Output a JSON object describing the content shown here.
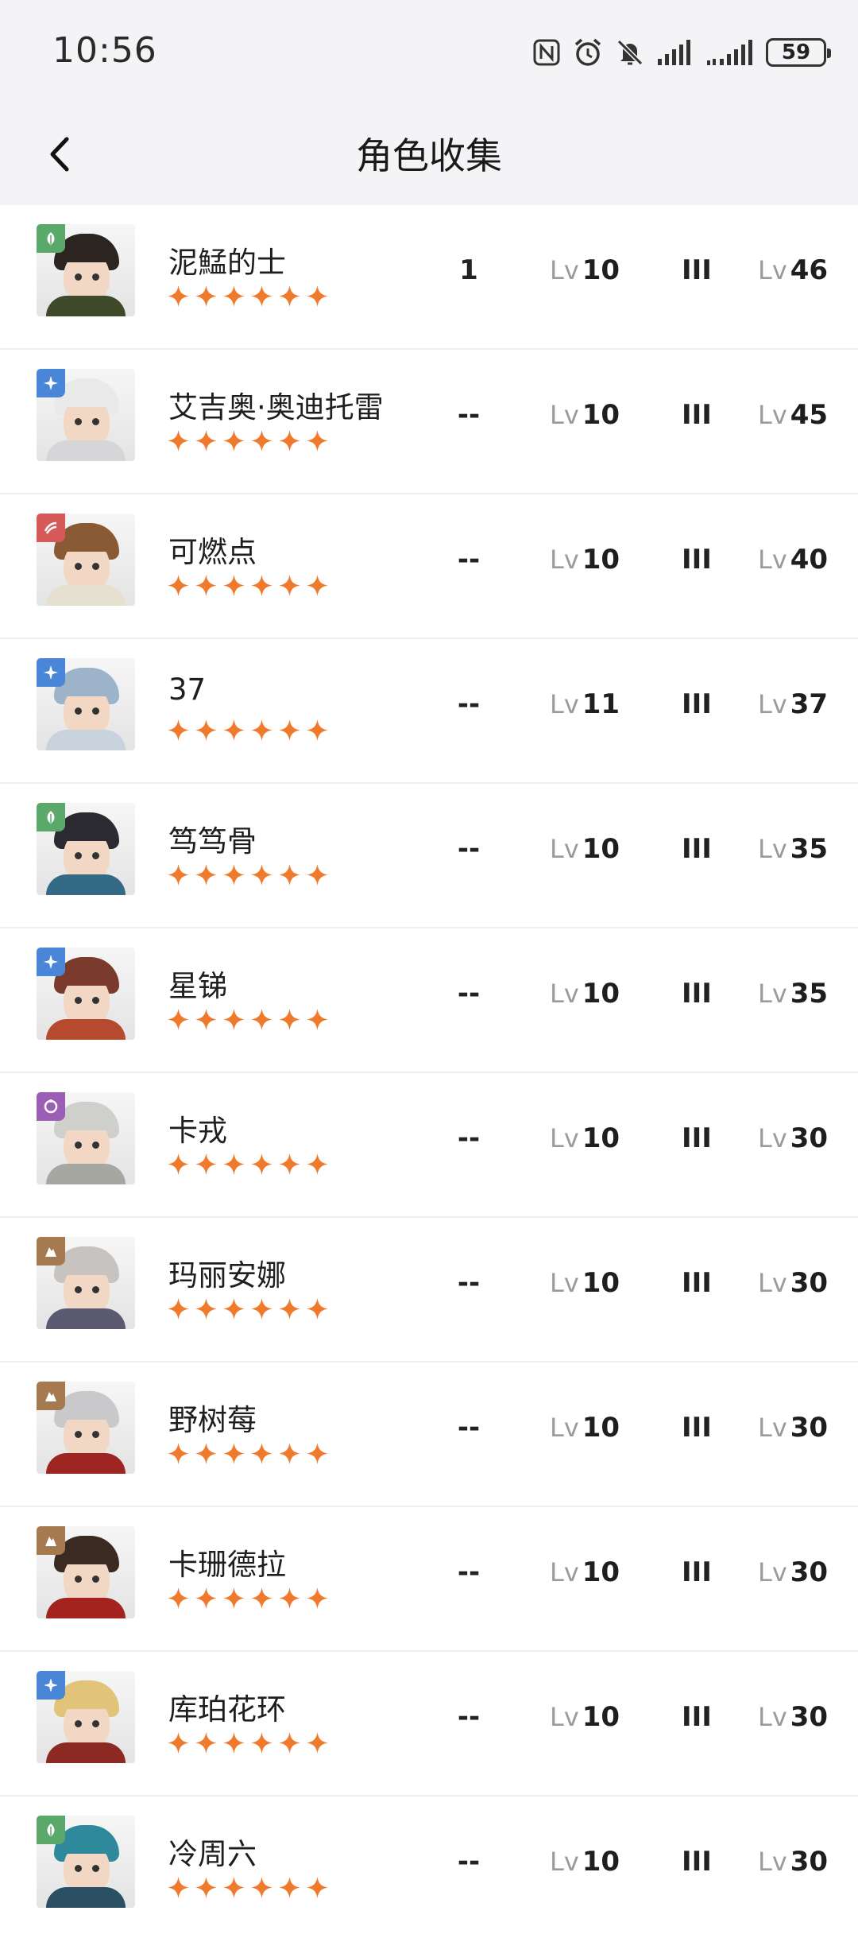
{
  "status_bar": {
    "time": "10:56",
    "battery": "59"
  },
  "header": {
    "title": "角色收集"
  },
  "characters": [
    {
      "name": "泥鯭的士",
      "rank": "1",
      "lv_label": "Lv",
      "level": "10",
      "roman": "III",
      "lv2_label": "Lv",
      "level2": "46",
      "element": "green",
      "hair": "#2c2420",
      "body": "#3f4a2a"
    },
    {
      "name": "艾吉奥·奥迪托雷",
      "rank": "--",
      "lv_label": "Lv",
      "level": "10",
      "roman": "III",
      "lv2_label": "Lv",
      "level2": "45",
      "element": "blue",
      "hair": "#e9e9ea",
      "body": "#d6d6d8"
    },
    {
      "name": "可燃点",
      "rank": "--",
      "lv_label": "Lv",
      "level": "10",
      "roman": "III",
      "lv2_label": "Lv",
      "level2": "40",
      "element": "red",
      "hair": "#8a5a34",
      "body": "#e6e0d0"
    },
    {
      "name": "37",
      "rank": "--",
      "lv_label": "Lv",
      "level": "11",
      "roman": "III",
      "lv2_label": "Lv",
      "level2": "37",
      "element": "blue",
      "hair": "#9db3c9",
      "body": "#c9d3de"
    },
    {
      "name": "笃笃骨",
      "rank": "--",
      "lv_label": "Lv",
      "level": "10",
      "roman": "III",
      "lv2_label": "Lv",
      "level2": "35",
      "element": "green",
      "hair": "#2b2a33",
      "body": "#356a86"
    },
    {
      "name": "星锑",
      "rank": "--",
      "lv_label": "Lv",
      "level": "10",
      "roman": "III",
      "lv2_label": "Lv",
      "level2": "35",
      "element": "blue",
      "hair": "#7a3a2c",
      "body": "#b54a2e"
    },
    {
      "name": "卡戎",
      "rank": "--",
      "lv_label": "Lv",
      "level": "10",
      "roman": "III",
      "lv2_label": "Lv",
      "level2": "30",
      "element": "purple",
      "hair": "#cfcfcb",
      "body": "#a7a7a2"
    },
    {
      "name": "玛丽安娜",
      "rank": "--",
      "lv_label": "Lv",
      "level": "10",
      "roman": "III",
      "lv2_label": "Lv",
      "level2": "30",
      "element": "brown",
      "hair": "#c7c3c0",
      "body": "#5b5a70"
    },
    {
      "name": "野树莓",
      "rank": "--",
      "lv_label": "Lv",
      "level": "10",
      "roman": "III",
      "lv2_label": "Lv",
      "level2": "30",
      "element": "brown",
      "hair": "#c9c9cb",
      "body": "#9e2622"
    },
    {
      "name": "卡珊德拉",
      "rank": "--",
      "lv_label": "Lv",
      "level": "10",
      "roman": "III",
      "lv2_label": "Lv",
      "level2": "30",
      "element": "brown",
      "hair": "#3b2a22",
      "body": "#a5231e"
    },
    {
      "name": "库珀花环",
      "rank": "--",
      "lv_label": "Lv",
      "level": "10",
      "roman": "III",
      "lv2_label": "Lv",
      "level2": "30",
      "element": "blue",
      "hair": "#e1c47a",
      "body": "#8a2a22"
    },
    {
      "name": "冷周六",
      "rank": "--",
      "lv_label": "Lv",
      "level": "10",
      "roman": "III",
      "lv2_label": "Lv",
      "level2": "30",
      "element": "green",
      "hair": "#2e8a9a",
      "body": "#2b4f63"
    }
  ],
  "colors": {
    "star": "#f07a2c",
    "green": "#5aa86a",
    "blue": "#4a86d8",
    "red": "#d65a5a",
    "purple": "#9a5fb5",
    "brown": "#a57a50",
    "header_bg": "#f4f4f6"
  },
  "icons": {
    "back": "chevron-left-icon",
    "star": "sparkle-star-icon"
  }
}
